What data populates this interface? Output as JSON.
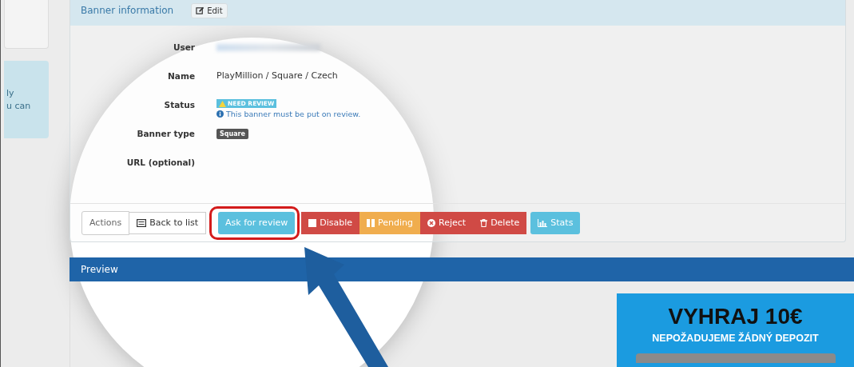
{
  "sidebar": {
    "notice_lines": [
      "ly",
      "u can"
    ]
  },
  "banner_panel": {
    "title": "Banner information",
    "edit_button": "Edit",
    "fields": [
      {
        "label": "User",
        "kind": "blurred"
      },
      {
        "label": "Name",
        "kind": "text",
        "value": "PlayMillion / Square / Czech"
      },
      {
        "label": "Status",
        "kind": "status",
        "badge": "NEED REVIEW",
        "note": "This banner must be put on review."
      },
      {
        "label": "Banner type",
        "kind": "tag",
        "value": "Square"
      },
      {
        "label": "URL (optional)",
        "kind": "empty"
      }
    ],
    "actions": {
      "label": "Actions",
      "buttons": [
        {
          "label": "Back to list",
          "kind": "back",
          "highlighted": false
        },
        {
          "label": "Ask for review",
          "kind": "review",
          "highlighted": true
        },
        {
          "label": "Disable",
          "kind": "disable",
          "highlighted": false
        },
        {
          "label": "Pending",
          "kind": "pending",
          "highlighted": false
        },
        {
          "label": "Reject",
          "kind": "reject",
          "highlighted": false
        },
        {
          "label": "Delete",
          "kind": "delete",
          "highlighted": false
        },
        {
          "label": "Stats",
          "kind": "stats",
          "highlighted": false
        }
      ]
    }
  },
  "preview": {
    "title": "Preview",
    "banner": {
      "headline": "VYHRAJ 10€",
      "subline": "NEPOŽADUJEME ŽÁDNÝ DEPOZIT"
    }
  }
}
